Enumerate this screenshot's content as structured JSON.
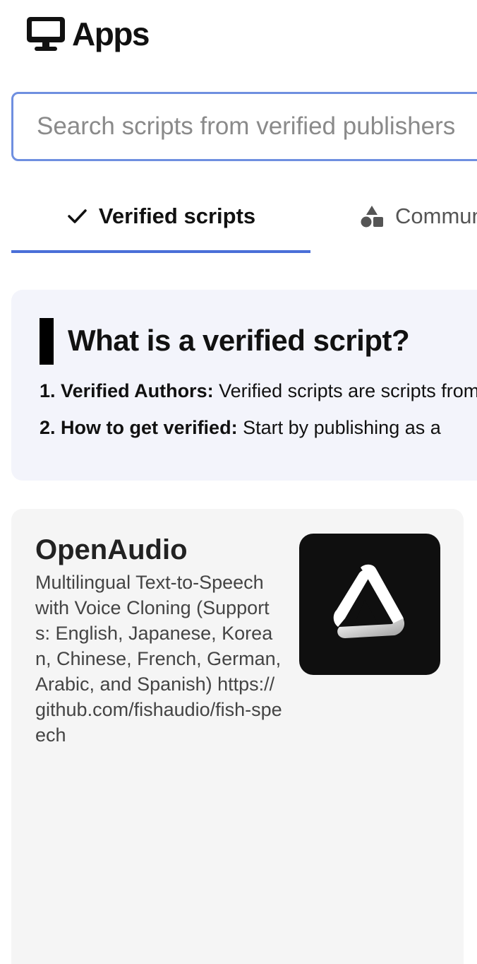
{
  "header": {
    "title": "Apps",
    "icon": "monitor-icon"
  },
  "search": {
    "placeholder": "Search scripts from verified publishers",
    "value": ""
  },
  "tabs": [
    {
      "label": "Verified scripts",
      "icon": "check-icon",
      "active": true
    },
    {
      "label": "Community scripts",
      "icon": "shapes-icon",
      "active": false
    }
  ],
  "info": {
    "title": "What is a verified script?",
    "items": [
      {
        "number": "1.",
        "label": "Verified Authors:",
        "text": "Verified scripts are scripts from"
      },
      {
        "number": "2.",
        "label": "How to get verified:",
        "text": "Start by publishing as a"
      }
    ]
  },
  "cards": [
    {
      "title": "OpenAudio",
      "description": "Multilingual Text-to-Speech with Voice Cloning (Supports: English, Japanese, Korean, Chinese, French, German, Arabic, and Spanish) https://github.com/fishaudio/fish-speech",
      "logo": "openaudio-logo-icon"
    }
  ],
  "colors": {
    "accent": "#4a6fd8",
    "search_border": "#6f8fe0",
    "info_bg": "#f3f4fb",
    "card_bg": "#f5f5f5",
    "logo_bg": "#0f0f0f"
  }
}
